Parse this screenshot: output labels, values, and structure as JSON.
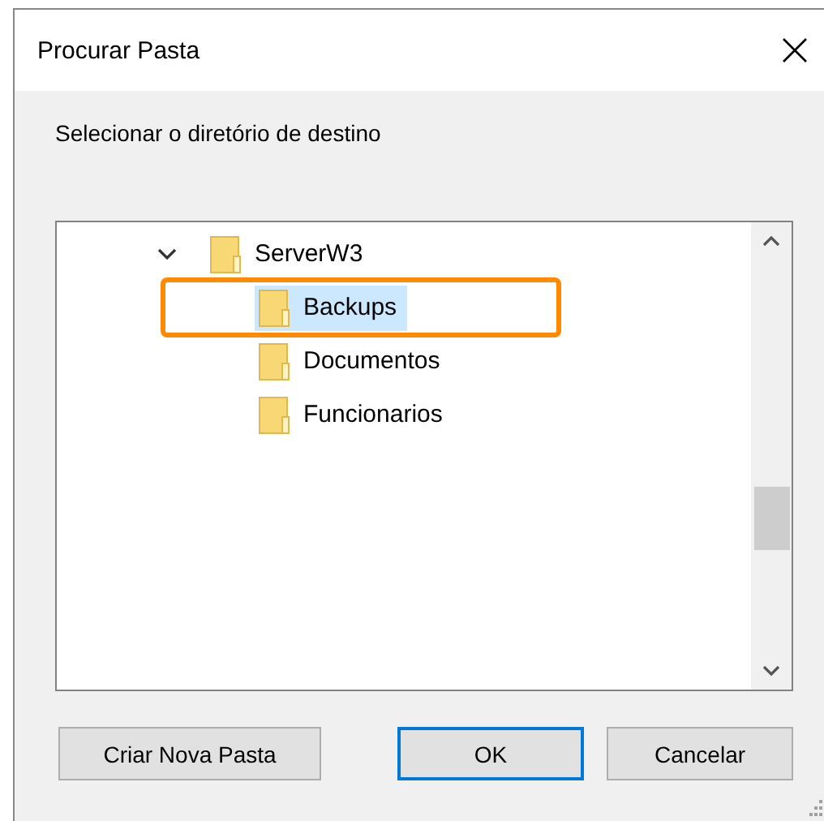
{
  "window": {
    "title": "Procurar Pasta"
  },
  "prompt": "Selecionar o diretório de destino",
  "tree": [
    {
      "label": "ServerW3",
      "expanded": true,
      "selected": false,
      "highlighted": false,
      "children": [
        {
          "label": "Backups",
          "selected": true,
          "highlighted": true
        },
        {
          "label": "Documentos",
          "selected": false,
          "highlighted": false
        },
        {
          "label": "Funcionarios",
          "selected": false,
          "highlighted": false
        }
      ]
    }
  ],
  "buttons": [
    {
      "label": "Criar Nova Pasta",
      "default": false
    },
    {
      "label": "OK",
      "default": true
    },
    {
      "label": "Cancelar",
      "default": false
    }
  ]
}
